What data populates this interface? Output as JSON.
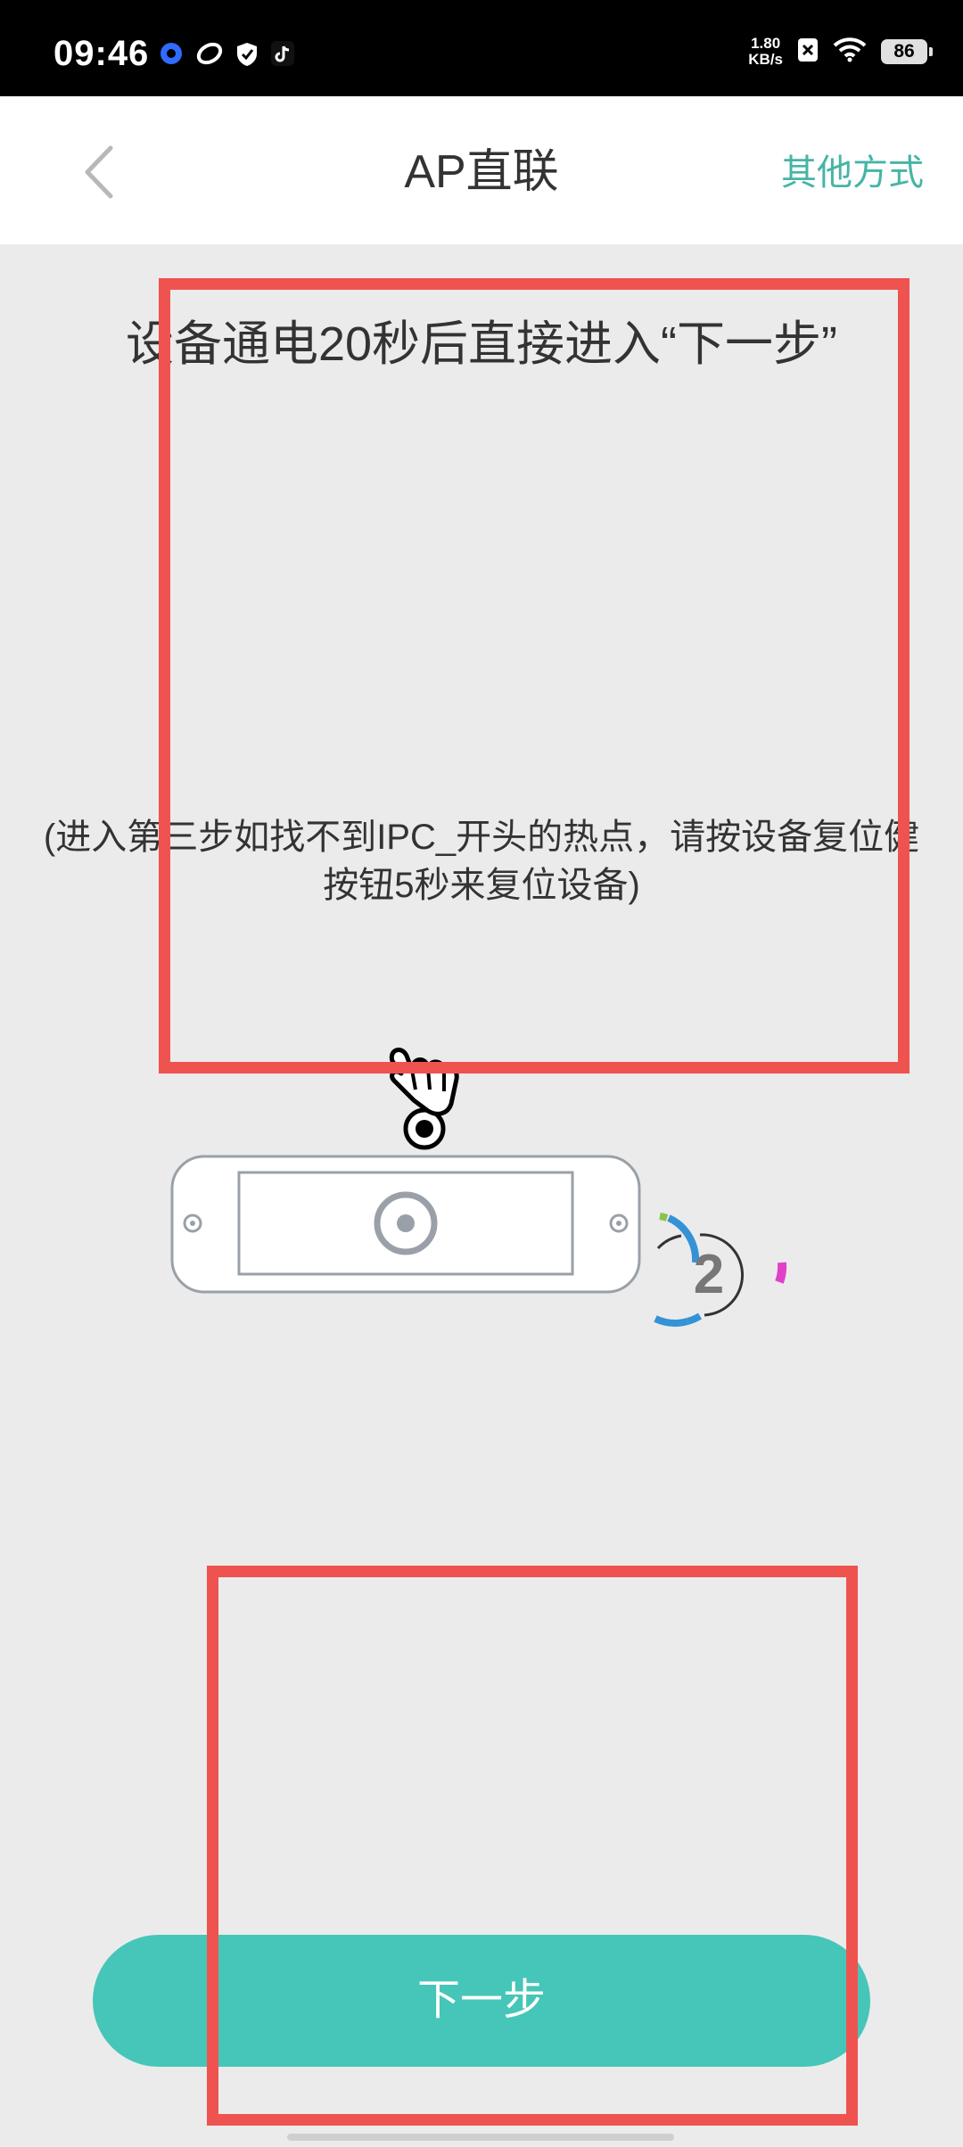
{
  "status_bar": {
    "time": "09:46",
    "net_speed_value": "1.80",
    "net_speed_unit": "KB/s",
    "battery": "86",
    "left_icons": [
      "baidu-map-icon",
      "app-swirl-icon",
      "shield-check-icon",
      "tiktok-icon"
    ],
    "right_icons": [
      "sim-x-icon",
      "wifi-icon",
      "battery-icon"
    ]
  },
  "header": {
    "title": "AP直联",
    "right_action": "其他方式"
  },
  "main": {
    "instruction_title": "设备通电20秒后直接进入“下一步”",
    "instruction_note": "(进入第三步如找不到IPC_开头的热点，请按设备复位健按钮5秒来复位设备)",
    "countdown_number": "2"
  },
  "footer": {
    "next_button": "下一步"
  },
  "colors": {
    "accent": "#45c6b8",
    "accent_text": "#45b5a5",
    "annotation": "#ef5350",
    "background": "#ebebeb"
  }
}
